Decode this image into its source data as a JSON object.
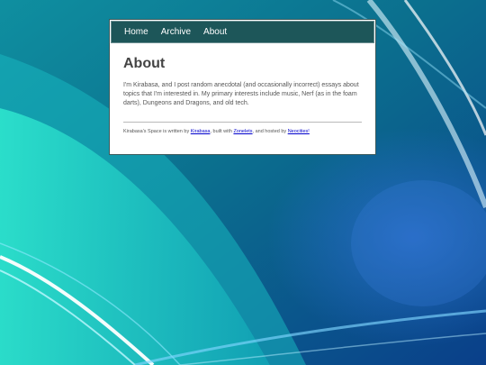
{
  "nav": {
    "home": "Home",
    "archive": "Archive",
    "about": "About"
  },
  "page": {
    "title": "About",
    "paragraph": "I'm Kirabasa, and I post random anecdotal (and occasionally incorrect) essays about topics that I'm interested in. My primary interests include music, Nerf (as in the foam darts), Dungeons and Dragons, and old tech."
  },
  "footer": {
    "text1": "Kirabasa's Space is written by ",
    "link_author": "Kirabasa",
    "text2": ", built with ",
    "link_builder": "Zonelets",
    "text3": ", and hosted by ",
    "link_host": "Neocities!"
  },
  "colors": {
    "nav_bg": "#1d5659",
    "background_teal": "#1fc8c0",
    "background_blue": "#0a4fa0",
    "link": "#0000cc"
  }
}
